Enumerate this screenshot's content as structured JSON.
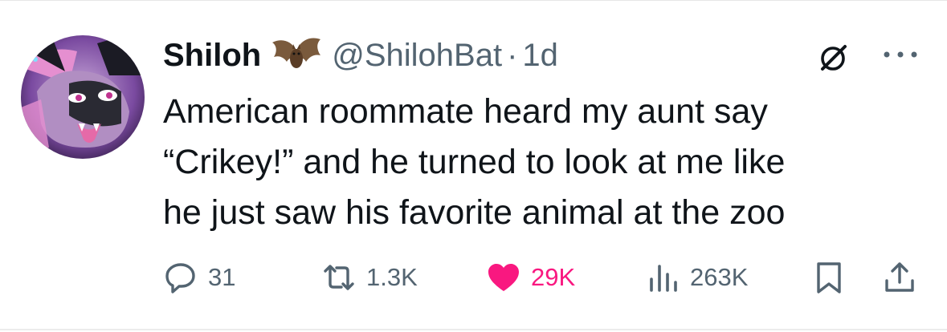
{
  "author": {
    "display_name": "Shiloh",
    "badge_icon": "bat-emoji-icon",
    "handle": "@ShilohBat",
    "separator": "·",
    "time": "1d"
  },
  "tweet": {
    "lines": [
      "American roommate heard my aunt say",
      "“Crikey!” and he turned to look at me like",
      "he just saw his favorite animal at the zoo"
    ]
  },
  "actions": {
    "replies": "31",
    "reposts": "1.3K",
    "likes": "29K",
    "views": "263K"
  },
  "colors": {
    "text": "#0f1419",
    "muted": "#536471",
    "like": "#f91880"
  }
}
